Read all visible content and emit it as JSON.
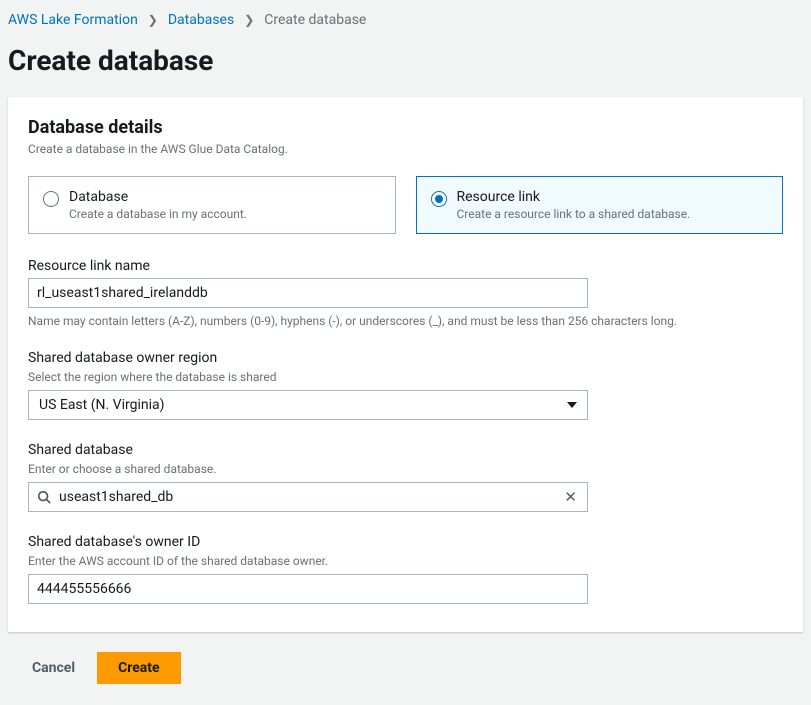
{
  "breadcrumb": {
    "items": [
      {
        "label": "AWS Lake Formation"
      },
      {
        "label": "Databases"
      }
    ],
    "current": "Create database"
  },
  "page": {
    "title": "Create database"
  },
  "details": {
    "title": "Database details",
    "description": "Create a database in the AWS Glue Data Catalog."
  },
  "options": {
    "database": {
      "title": "Database",
      "desc": "Create a database in my account."
    },
    "resource_link": {
      "title": "Resource link",
      "desc": "Create a resource link to a shared database."
    }
  },
  "form": {
    "resource_link_name": {
      "label": "Resource link name",
      "value": "rl_useast1shared_irelanddb",
      "hint": "Name may contain letters (A-Z), numbers (0-9), hyphens (-), or underscores (_), and must be less than 256 characters long."
    },
    "owner_region": {
      "label": "Shared database owner region",
      "help": "Select the region where the database is shared",
      "value": "US East (N. Virginia)"
    },
    "shared_database": {
      "label": "Shared database",
      "help": "Enter or choose a shared database.",
      "value": "useast1shared_db"
    },
    "owner_id": {
      "label": "Shared database's owner ID",
      "help": "Enter the AWS account ID of the shared database owner.",
      "value": "444455556666"
    }
  },
  "actions": {
    "cancel": "Cancel",
    "create": "Create"
  }
}
